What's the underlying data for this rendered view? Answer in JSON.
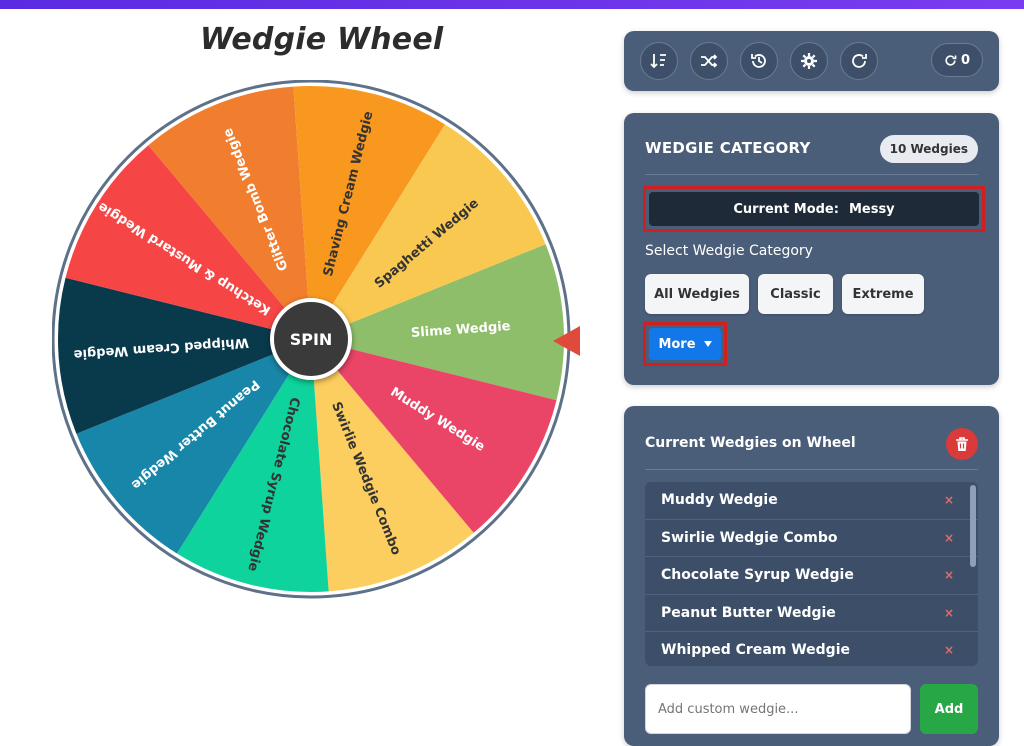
{
  "app": {
    "title": "Wedgie Wheel",
    "spin_label": "SPIN"
  },
  "wheel": {
    "segments": [
      {
        "label": "Slime Wedgie",
        "color": "#8fbe6a",
        "text_color": "#ffffff"
      },
      {
        "label": "Muddy Wedgie",
        "color": "#ea4466",
        "text_color": "#ffffff"
      },
      {
        "label": "Swirlie Wedgie Combo",
        "color": "#fccd5f",
        "text_color": "#333333"
      },
      {
        "label": "Chocolate Syrup Wedgie",
        "color": "#0ed39c",
        "text_color": "#333333"
      },
      {
        "label": "Peanut Butter Wedgie",
        "color": "#1886a8",
        "text_color": "#ffffff"
      },
      {
        "label": "Whipped Cream Wedgie",
        "color": "#093a4c",
        "text_color": "#ffffff"
      },
      {
        "label": "Ketchup & Mustard Wedgie",
        "color": "#f64545",
        "text_color": "#ffffff"
      },
      {
        "label": "Glitter Bomb Wedgie",
        "color": "#f17d2f",
        "text_color": "#ffffff"
      },
      {
        "label": "Shaving Cream Wedgie",
        "color": "#f8981f",
        "text_color": "#333333"
      },
      {
        "label": "Spaghetti Wedgie",
        "color": "#f9c850",
        "text_color": "#333333"
      }
    ]
  },
  "toolbar": {
    "icons": [
      "sort-icon",
      "shuffle-icon",
      "history-icon",
      "gear-icon",
      "redo-icon"
    ],
    "spin_count": "0"
  },
  "category": {
    "heading": "WEDGIE CATEGORY",
    "count_badge": "10 Wedgies",
    "mode_label": "Current Mode:",
    "mode_value": "Messy",
    "select_label": "Select Wedgie Category",
    "buttons": [
      "All Wedgies",
      "Classic",
      "Extreme"
    ],
    "more_label": "More"
  },
  "current": {
    "heading": "Current Wedgies on Wheel",
    "items": [
      "Muddy Wedgie",
      "Swirlie Wedgie Combo",
      "Chocolate Syrup Wedgie",
      "Peanut Butter Wedgie",
      "Whipped Cream Wedgie"
    ],
    "remove_glyph": "×",
    "input_placeholder": "Add custom wedgie...",
    "add_label": "Add"
  }
}
